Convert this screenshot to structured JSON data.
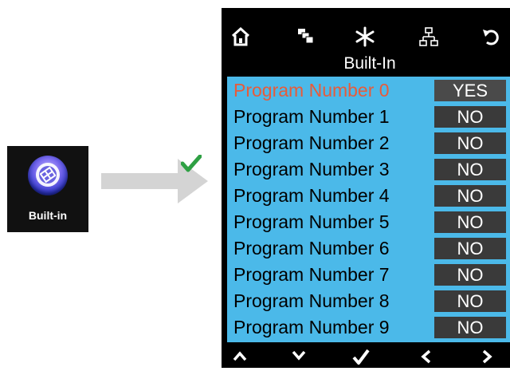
{
  "launcher": {
    "label": "Built-in",
    "icon": "film-reel-icon"
  },
  "device": {
    "toolbar": {
      "icons": [
        "home-icon",
        "layers-icon",
        "asterisk-icon",
        "network-icon",
        "back-icon"
      ]
    },
    "title": "Built-In",
    "rows": [
      {
        "name": "Program Number 0",
        "value": "YES"
      },
      {
        "name": "Program Number 1",
        "value": "NO"
      },
      {
        "name": "Program Number 2",
        "value": "NO"
      },
      {
        "name": "Program Number 3",
        "value": "NO"
      },
      {
        "name": "Program Number 4",
        "value": "NO"
      },
      {
        "name": "Program Number 5",
        "value": "NO"
      },
      {
        "name": "Program Number 6",
        "value": "NO"
      },
      {
        "name": "Program Number 7",
        "value": "NO"
      },
      {
        "name": "Program Number 8",
        "value": "NO"
      },
      {
        "name": "Program Number 9",
        "value": "NO"
      }
    ],
    "nav": {
      "icons": [
        "up-icon",
        "down-icon",
        "confirm-check-icon",
        "left-icon",
        "right-icon"
      ]
    }
  },
  "colors": {
    "panel": "#4bb9e9",
    "active_text": "#e85b3a",
    "value_bg": "#3a3a3a",
    "check": "#2ea043"
  }
}
